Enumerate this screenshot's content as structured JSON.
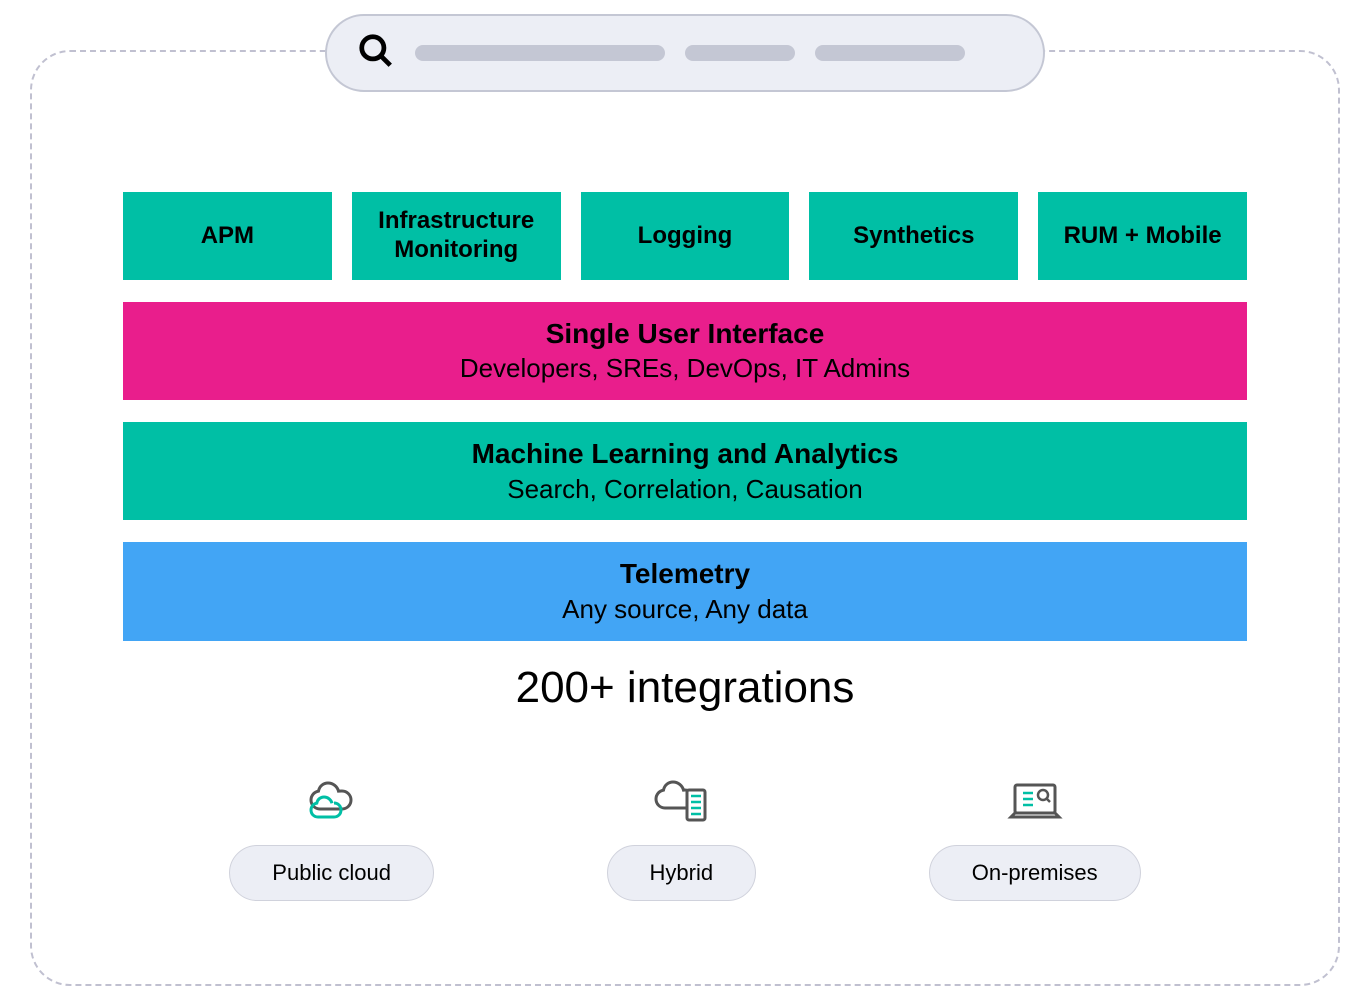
{
  "top_boxes": {
    "apm": "APM",
    "infra": "Infrastructure Monitoring",
    "logging": "Logging",
    "synthetics": "Synthetics",
    "rum": "RUM + Mobile"
  },
  "bands": {
    "ui": {
      "title": "Single User Interface",
      "sub": "Developers, SREs, DevOps, IT Admins"
    },
    "ml": {
      "title": "Machine Learning and Analytics",
      "sub": "Search, Correlation, Causation"
    },
    "telemetry": {
      "title": "Telemetry",
      "sub": "Any source, Any data"
    }
  },
  "integrations": "200+ integrations",
  "deploy": {
    "public": "Public cloud",
    "hybrid": "Hybrid",
    "onprem": "On-premises"
  },
  "colors": {
    "teal": "#00BFA5",
    "pink": "#E91E8C",
    "blue": "#42A5F5",
    "gray_bg": "#eceef5",
    "gray_border": "#c4c7d4"
  }
}
